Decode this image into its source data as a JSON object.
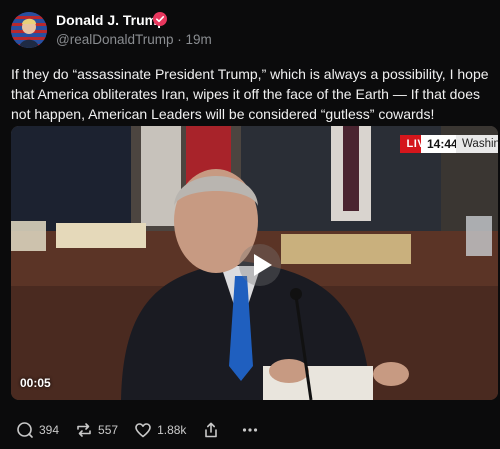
{
  "post": {
    "author_name": "Donald J. Trump",
    "handle": "@realDonaldTrump · 19m",
    "text": "If they do “assassinate President Trump,” which is always a possibility, I hope that America obliterates Iran, wipes it off the face of the Earth — If that does not happen, American Leaders will be considered “gutless” cowards!"
  },
  "video": {
    "live_label": "LIVE",
    "clock": "14:44",
    "location": "Washington",
    "duration": "00:05"
  },
  "actions": {
    "replies": "394",
    "reposts": "557",
    "likes": "1.88k"
  },
  "colors": {
    "verified_badge": "#e8375e",
    "live_red": "#d4161c",
    "background": "#0b0b0c"
  }
}
